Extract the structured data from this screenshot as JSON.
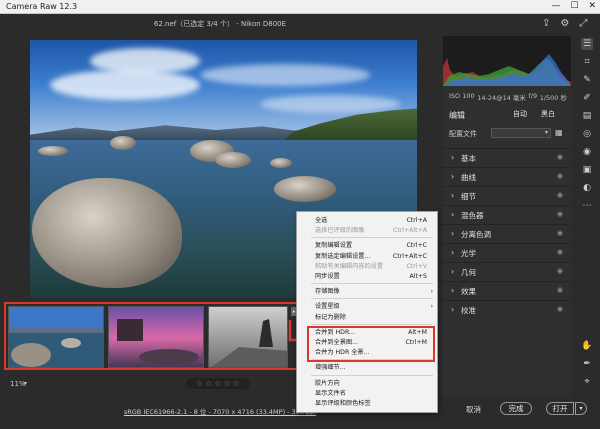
{
  "window": {
    "app_title": "Camera Raw 12.3",
    "minimize": "—",
    "maximize": "☐",
    "close": "✕"
  },
  "file_title": "62.nef（已选定 3/4 个） - Nikon D800E",
  "top_icons": [
    "export-icon",
    "gear-icon",
    "fullscreen-icon"
  ],
  "info": {
    "iso": "ISO 100",
    "lens": "14-24@14 毫米",
    "aperture": "f/9",
    "shutter": "1/500 秒"
  },
  "edit_panel": {
    "title": "编辑",
    "auto": "自动",
    "bw": "黑白",
    "profile_label": "配置文件",
    "profile_value": "",
    "sections": [
      "基本",
      "曲线",
      "细节",
      "混色器",
      "分离色调",
      "光学",
      "几何",
      "效果",
      "校准"
    ]
  },
  "tools": [
    "sliders-icon",
    "crop-icon",
    "heal-icon",
    "brush-icon",
    "gradient-icon",
    "radial-icon",
    "redeye-icon",
    "snapshot-icon",
    "presets-icon",
    "more-icon"
  ],
  "bottom_tools": [
    "hand-icon",
    "eyedropper-icon",
    "color-sampler-icon"
  ],
  "bottombar": {
    "zoom": "11%",
    "stars": [
      "☆",
      "☆",
      "☆",
      "☆",
      "☆"
    ]
  },
  "statusbar": {
    "color_info": "sRGB IEC61966-2.1 - 8 位 - 7070 x 4716 (33.4MP) - 300 ppi",
    "cancel": "取消",
    "done": "完成",
    "open": "打开"
  },
  "filmstrip": {
    "more_label": "•••"
  },
  "context_menu": {
    "items": [
      {
        "label": "全选",
        "shortcut": "Ctrl+A",
        "disabled": false
      },
      {
        "label": "选择已评级的图像",
        "shortcut": "Ctrl+Alt+A",
        "disabled": true
      },
      {
        "sep": true
      },
      {
        "label": "复制编辑设置",
        "shortcut": "Ctrl+C",
        "disabled": false
      },
      {
        "label": "复制选定编辑设置...",
        "shortcut": "Ctrl+Alt+C",
        "disabled": false
      },
      {
        "label": "粘贴有关编辑内容的设置",
        "shortcut": "Ctrl+V",
        "disabled": true
      },
      {
        "label": "同步设置",
        "shortcut": "Alt+S",
        "disabled": false
      },
      {
        "sep": true
      },
      {
        "label": "存储图像",
        "shortcut": "",
        "submenu": true,
        "disabled": false
      },
      {
        "sep": true
      },
      {
        "label": "设置星级",
        "shortcut": "",
        "submenu": true,
        "disabled": false
      },
      {
        "label": "标记为删除",
        "shortcut": "",
        "disabled": false
      },
      {
        "sep": true
      },
      {
        "label": "合并到 HDR...",
        "shortcut": "Alt+M",
        "disabled": false
      },
      {
        "label": "合并到全景图...",
        "shortcut": "Ctrl+M",
        "disabled": false
      },
      {
        "label": "合并为 HDR 全景...",
        "shortcut": "",
        "disabled": false
      },
      {
        "sep": true
      },
      {
        "label": "增强细节...",
        "shortcut": "",
        "disabled": false
      },
      {
        "sep": true
      },
      {
        "label": "胶片方向",
        "shortcut": "",
        "disabled": false
      },
      {
        "label": "显示文件名",
        "shortcut": "",
        "disabled": false
      },
      {
        "label": "显示评级和颜色标签",
        "shortcut": "",
        "disabled": false
      }
    ]
  }
}
